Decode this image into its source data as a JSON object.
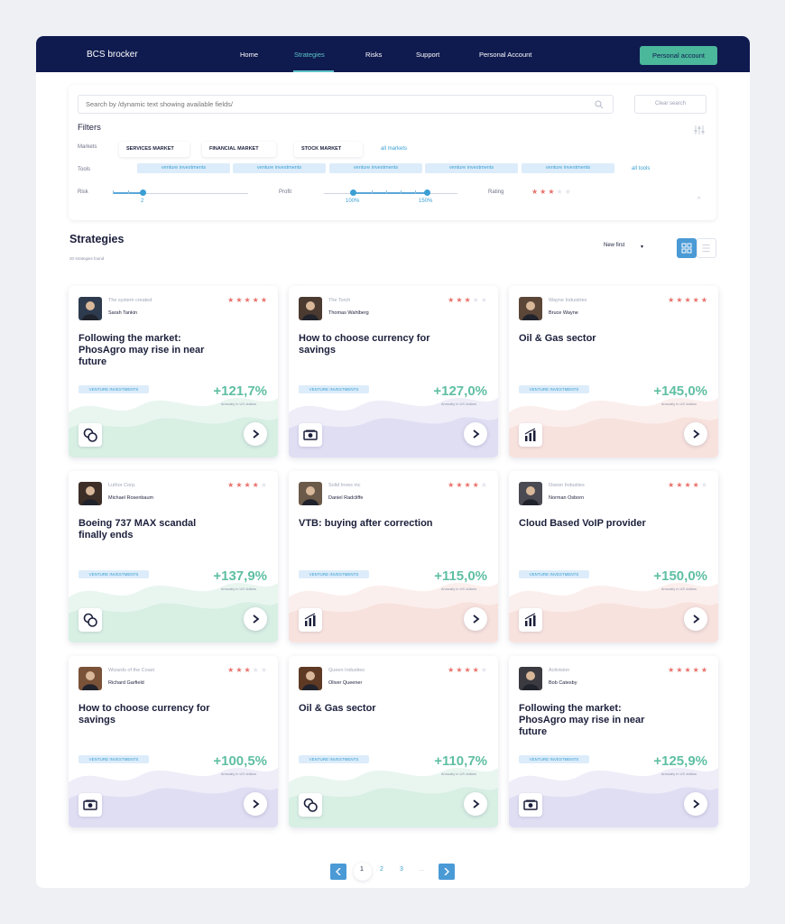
{
  "nav": {
    "brand": "BCS brocker",
    "links": [
      "Home",
      "Strategies",
      "Risks",
      "Support",
      "Personal Account"
    ],
    "active": "Strategies",
    "account_button": "Personal account"
  },
  "search": {
    "placeholder": "Search by /dynamic text showing available fields/",
    "clear_label": "Clear search"
  },
  "filters": {
    "title": "Filters",
    "markets_label": "Markets",
    "markets": [
      "SERVICES MARKET",
      "FINANCIAL MARKET",
      "STOCK MARKET"
    ],
    "all_markets": "all markets",
    "tools_label": "Tools",
    "tools": [
      "venture investments",
      "venture investments",
      "venture investments",
      "venture investments",
      "venture investments"
    ],
    "all_tools": "all tools",
    "risk_label": "Risk",
    "risk_value": "2",
    "profit_label": "Profit",
    "profit_min": "100%",
    "profit_max": "150%",
    "rating_label": "Rating",
    "rating_value": 3
  },
  "strategies": {
    "title": "Strategies",
    "count": "20 strategies found",
    "sort": "New first",
    "colors": {
      "positive": "#5fbfa3",
      "star": "#e9706a",
      "accent": "#3a9fd3",
      "nav": "#0f1a4f"
    },
    "cards": [
      {
        "company": "The system created",
        "person": "Sarah Tankin",
        "rating": 5,
        "title": "Following the market: PhosAgro may rise in near future",
        "tag": "VENTURE INVESTMENTS",
        "pct": "+121,7%",
        "annual": "Annually in US dollars",
        "icon": "coins-icon",
        "theme": "green"
      },
      {
        "company": "The Torch",
        "person": "Thomas Wahlberg",
        "rating": 3,
        "title": "How to choose currency for savings",
        "tag": "VENTURE INVESTMENTS",
        "pct": "+127,0%",
        "annual": "Annually in US dollars",
        "icon": "cash-icon",
        "theme": "purple"
      },
      {
        "company": "Wayne Industries",
        "person": "Bruce Wayne",
        "rating": 5,
        "title": "Oil & Gas sector",
        "tag": "VENTURE INVESTMENTS",
        "pct": "+145,0%",
        "annual": "Annually in US dollars",
        "icon": "chart-icon",
        "theme": "red"
      },
      {
        "company": "Luthor Corp.",
        "person": "Michael Rosenbaum",
        "rating": 4,
        "title": "Boeing 737 MAX scandal finally ends",
        "tag": "VENTURE INVESTMENTS",
        "pct": "+137,9%",
        "annual": "Annually in US dollars",
        "icon": "coins-icon",
        "theme": "green"
      },
      {
        "company": "Solid Inves inc",
        "person": "Daniel Radcliffe",
        "rating": 4,
        "title": "VTB: buying after correction",
        "tag": "VENTURE INVESTMENTS",
        "pct": "+115,0%",
        "annual": "Annually in US dollars",
        "icon": "chart-icon",
        "theme": "red"
      },
      {
        "company": "Oseon Industies",
        "person": "Norman Osborn",
        "rating": 4,
        "title": "Cloud Based VoIP provider",
        "tag": "VENTURE INVESTMENTS",
        "pct": "+150,0%",
        "annual": "Annually in US dollars",
        "icon": "chart-icon",
        "theme": "red"
      },
      {
        "company": "Wizards of the Coast",
        "person": "Richard Garfield",
        "rating": 3,
        "title": "How to choose currency for savings",
        "tag": "VENTURE INVESTMENTS",
        "pct": "+100,5%",
        "annual": "Annually in US dollars",
        "icon": "cash-icon",
        "theme": "purple"
      },
      {
        "company": "Queen Industies",
        "person": "Oliver Queener",
        "rating": 4,
        "title": "Oil & Gas sector",
        "tag": "VENTURE INVESTMENTS",
        "pct": "+110,7%",
        "annual": "Annually in US dollars",
        "icon": "coins-icon",
        "theme": "green"
      },
      {
        "company": "Activision",
        "person": "Bob Catesby",
        "rating": 5,
        "title": "Following the market: PhosAgro may rise in near future",
        "tag": "VENTURE INVESTMENTS",
        "pct": "+125,9%",
        "annual": "Annually in US dollars",
        "icon": "cash-icon",
        "theme": "purple"
      }
    ]
  },
  "pagination": {
    "pages": [
      "1",
      "2",
      "3",
      "..."
    ],
    "current": "1"
  }
}
